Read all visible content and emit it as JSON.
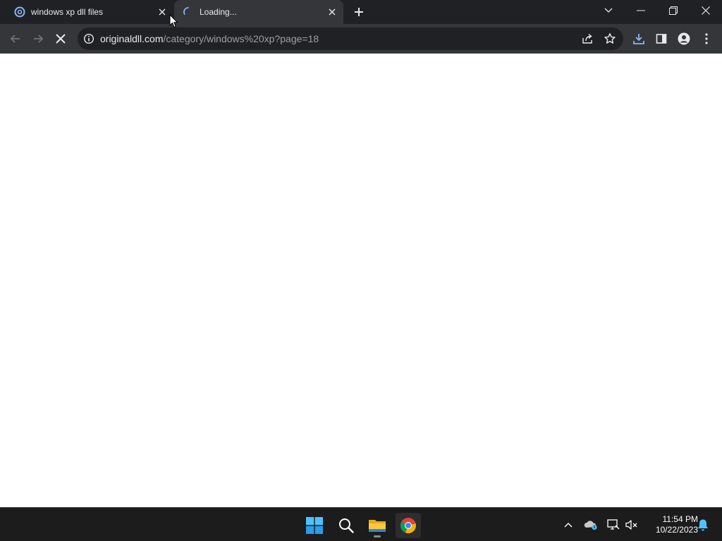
{
  "browser": {
    "tabs": [
      {
        "title": "windows xp dll files",
        "state": "inactive",
        "favicon": "originaldll-logo-icon"
      },
      {
        "title": "Loading...",
        "state": "active",
        "favicon": "loading-spinner-icon"
      }
    ],
    "new_tab_icon": "plus-icon",
    "window_controls": [
      "tab-search-icon",
      "minimize-icon",
      "restore-icon",
      "close-icon"
    ],
    "toolbar": {
      "back_icon": "arrow-left-icon",
      "forward_icon": "arrow-right-icon",
      "stop_icon": "close-icon",
      "url_domain": "originaldll.com",
      "url_path": "/category/windows%20xp?page=18",
      "right_icons": [
        "share-icon",
        "star-icon",
        "download-icon",
        "side-panel-icon",
        "profile-icon",
        "more-vert-icon"
      ]
    }
  },
  "taskbar": {
    "apps": [
      "windows-start-icon",
      "search-icon",
      "file-explorer-icon",
      "chrome-icon"
    ],
    "tray_icons": [
      "chevron-up-icon",
      "onedrive-icon",
      "display-icon",
      "volume-muted-icon"
    ],
    "time": "11:54 PM",
    "date": "10/22/2023",
    "notification_icon": "bell-icon"
  },
  "colors": {
    "titlebar": "#202124",
    "toolbar": "#35363a",
    "accent": "#8ab4f8",
    "download_accent": "#8ab4f8",
    "taskbar": "#1c1c1c"
  }
}
